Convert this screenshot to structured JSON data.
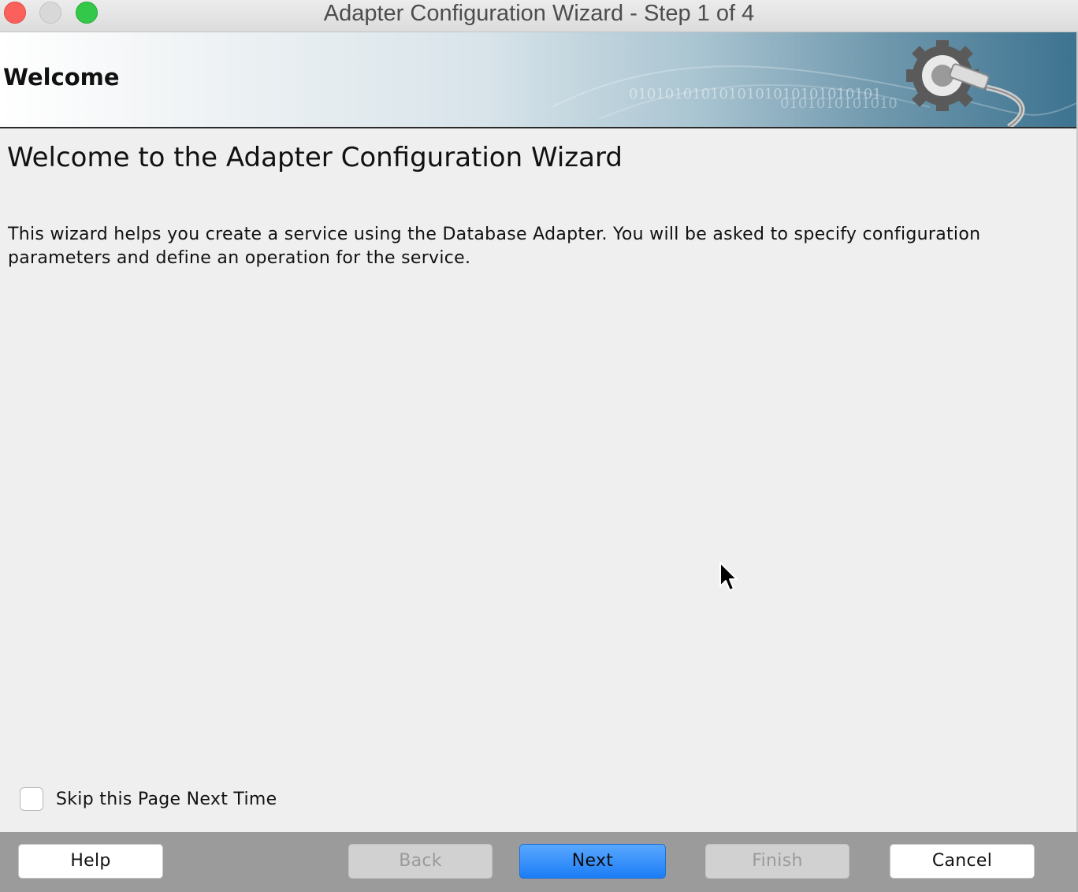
{
  "window": {
    "title": "Adapter Configuration Wizard - Step 1 of 4"
  },
  "banner": {
    "title": "Welcome",
    "binary_line_1": "0101010101010101010101010101",
    "binary_line_2": "0101010101010"
  },
  "content": {
    "heading": "Welcome to the Adapter Configuration Wizard",
    "description": "This wizard helps you create a service using the Database Adapter. You will be asked to specify configuration parameters and define an operation for the service."
  },
  "skip_option": {
    "label": "Skip this Page Next Time",
    "checked": false
  },
  "buttons": {
    "help": "Help",
    "back": "Back",
    "next": "Next",
    "finish": "Finish",
    "cancel": "Cancel"
  },
  "icons": {
    "banner": "gear-plug-icon",
    "cursor": "mouse-pointer-icon"
  }
}
